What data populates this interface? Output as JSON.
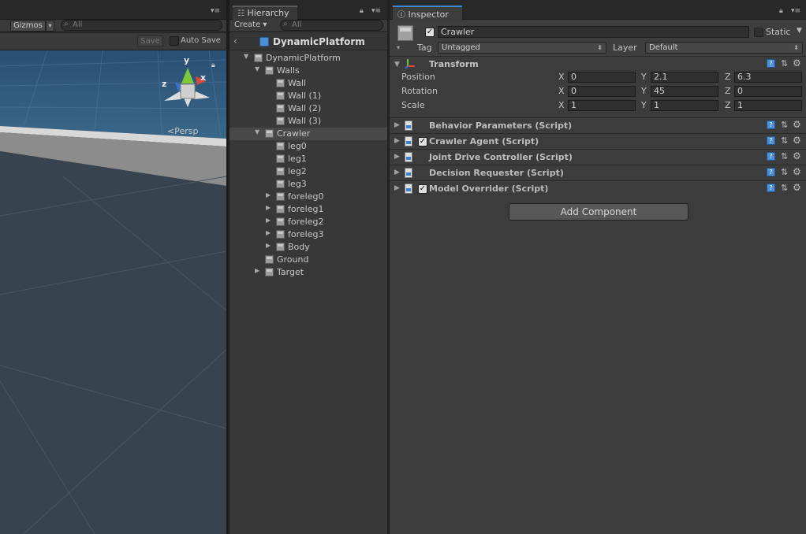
{
  "scene": {
    "gizmos_label": "Gizmos",
    "search_placeholder": "All",
    "save_label": "Save",
    "autosave_label": "Auto Save",
    "persp_label": "Persp",
    "axis_labels": {
      "y": "y",
      "z": "z",
      "x": "x"
    }
  },
  "hierarchy": {
    "tab_label": "Hierarchy",
    "create_label": "Create",
    "search_placeholder": "All",
    "scene_name": "DynamicPlatform",
    "items": [
      {
        "label": "DynamicPlatform",
        "depth": 0,
        "expanded": true
      },
      {
        "label": "Walls",
        "depth": 1,
        "expanded": true
      },
      {
        "label": "Wall",
        "depth": 2
      },
      {
        "label": "Wall (1)",
        "depth": 2
      },
      {
        "label": "Wall (2)",
        "depth": 2
      },
      {
        "label": "Wall (3)",
        "depth": 2
      },
      {
        "label": "Crawler",
        "depth": 1,
        "expanded": true,
        "selected": true
      },
      {
        "label": "leg0",
        "depth": 2
      },
      {
        "label": "leg1",
        "depth": 2
      },
      {
        "label": "leg2",
        "depth": 2
      },
      {
        "label": "leg3",
        "depth": 2
      },
      {
        "label": "foreleg0",
        "depth": 2,
        "collapsed": true
      },
      {
        "label": "foreleg1",
        "depth": 2,
        "collapsed": true
      },
      {
        "label": "foreleg2",
        "depth": 2,
        "collapsed": true
      },
      {
        "label": "foreleg3",
        "depth": 2,
        "collapsed": true
      },
      {
        "label": "Body",
        "depth": 2,
        "collapsed": true
      },
      {
        "label": "Ground",
        "depth": 1
      },
      {
        "label": "Target",
        "depth": 1,
        "collapsed": true
      }
    ]
  },
  "inspector": {
    "tab_label": "Inspector",
    "object_name": "Crawler",
    "static_label": "Static",
    "tag_label": "Tag",
    "tag_value": "Untagged",
    "layer_label": "Layer",
    "layer_value": "Default",
    "transform": {
      "title": "Transform",
      "rows": [
        {
          "label": "Position",
          "x": "0",
          "y": "2.1",
          "z": "6.3"
        },
        {
          "label": "Rotation",
          "x": "0",
          "y": "45",
          "z": "0"
        },
        {
          "label": "Scale",
          "x": "1",
          "y": "1",
          "z": "1"
        }
      ],
      "axis_x": "X",
      "axis_y": "Y",
      "axis_z": "Z"
    },
    "components": [
      {
        "name": "Behavior Parameters (Script)",
        "toggle": false
      },
      {
        "name": "Crawler Agent (Script)",
        "toggle": true
      },
      {
        "name": "Joint Drive Controller (Script)",
        "toggle": false
      },
      {
        "name": "Decision Requester (Script)",
        "toggle": false
      },
      {
        "name": "Model Overrider (Script)",
        "toggle": true
      }
    ],
    "add_component_label": "Add Component"
  }
}
